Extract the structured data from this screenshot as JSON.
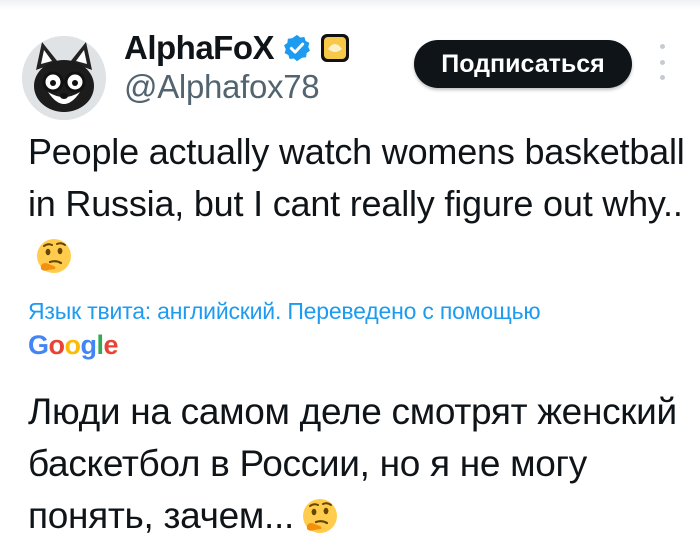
{
  "author": {
    "display_name": "AlphaFoX",
    "handle": "@Alphafox78",
    "avatar": "fox-with-glasses-avatar",
    "badges": [
      "verified-check-icon",
      "gold-affiliate-badge-icon"
    ]
  },
  "subscribe_button": {
    "label": "Подписаться"
  },
  "more_menu": {
    "icon": "more-vertical-icon"
  },
  "tweet": {
    "text": "People actually watch womens basketball in Russia, but I cant really figure out why..",
    "emoji": "thinking-face-icon"
  },
  "translation": {
    "note": "Язык твита: английский. Переведено с помощью",
    "provider": "Google",
    "text": "Люди на самом деле смотрят женский баскетбол в России, но я не могу понять, зачем...",
    "emoji": "thinking-face-icon"
  },
  "colors": {
    "text": "#0f1419",
    "secondary": "#536471",
    "link": "#1d9bf0",
    "verified": "#1d9bf0",
    "button_bg": "#0f1419",
    "google_blue": "#4285f4",
    "google_red": "#ea4335",
    "google_yellow": "#fbbc05",
    "google_green": "#34a853"
  }
}
